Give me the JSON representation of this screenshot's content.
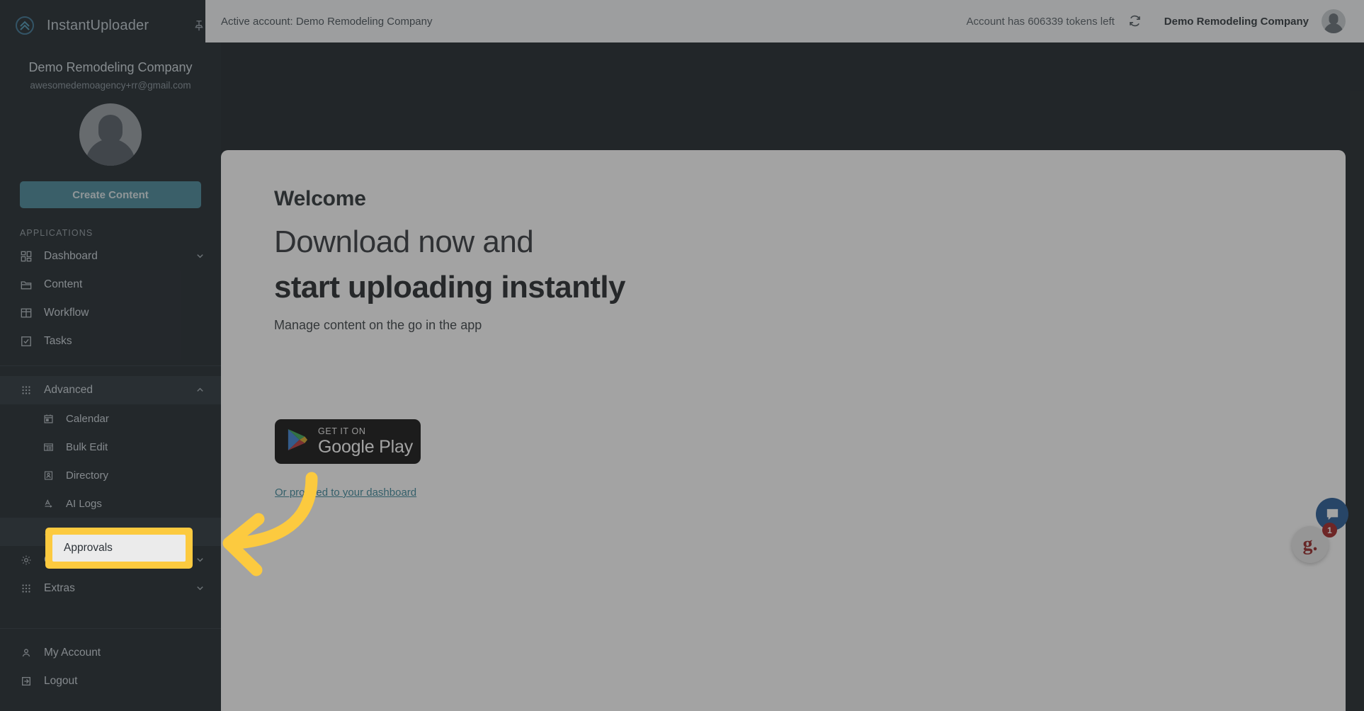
{
  "brand": {
    "name": "InstantUploader",
    "logo_icon": "chevrons-up-circle-icon",
    "pin_icon": "pin-icon"
  },
  "sidebar": {
    "account_name": "Demo Remodeling Company",
    "account_email": "awesomedemoagency+rr@gmail.com",
    "avatar_icon": "user-avatar",
    "create_button": "Create Content",
    "section_label": "APPLICATIONS",
    "items": [
      {
        "label": "Dashboard",
        "icon": "dashboard-grid-icon",
        "chevron": "chevron-down-icon"
      },
      {
        "label": "Content",
        "icon": "folder-icon"
      },
      {
        "label": "Workflow",
        "icon": "table-icon"
      },
      {
        "label": "Tasks",
        "icon": "checkbox-icon"
      }
    ],
    "advanced": {
      "label": "Advanced",
      "icon": "apps-dots-icon",
      "chevron": "chevron-up-icon",
      "children": [
        {
          "label": "Calendar",
          "icon": "calendar-icon"
        },
        {
          "label": "Bulk Edit",
          "icon": "list-table-icon"
        },
        {
          "label": "Directory",
          "icon": "contact-card-icon"
        },
        {
          "label": "AI Logs",
          "icon": "text-format-icon"
        },
        {
          "label": "Approvals",
          "icon": "text-format-icon"
        }
      ]
    },
    "tail_items": [
      {
        "label": "Config",
        "icon": "gear-icon",
        "chevron": "chevron-down-icon"
      },
      {
        "label": "Extras",
        "icon": "apps-dots-icon",
        "chevron": "chevron-down-icon"
      }
    ],
    "bottom_items": [
      {
        "label": "My Account",
        "icon": "person-icon"
      },
      {
        "label": "Logout",
        "icon": "logout-arrow-icon"
      }
    ]
  },
  "header": {
    "active_account": "Active account: Demo Remodeling Company",
    "tokens": "Account has 606339 tokens left",
    "refresh_icon": "refresh-icon",
    "account_name": "Demo Remodeling Company",
    "avatar_icon": "user-avatar"
  },
  "main": {
    "welcome": "Welcome",
    "headline_light": "Download now and",
    "headline_bold": "start uploading instantly",
    "subtext": "Manage content on the go in the app",
    "google_play": {
      "small": "GET IT ON",
      "big": "Google Play",
      "icon": "google-play-triangle-icon"
    },
    "dashboard_link": "Or proceed to your dashboard"
  },
  "annotation": {
    "highlight_label": "Approvals",
    "highlight_color": "#fcca3f",
    "arrow_icon": "curved-left-arrow-annotation"
  },
  "widgets": {
    "chat_icon": "chat-bubble-icon",
    "chat_color": "#164f8f",
    "g_widget_label": "g.",
    "badge_count": "1",
    "badge_color": "#9b1414"
  }
}
